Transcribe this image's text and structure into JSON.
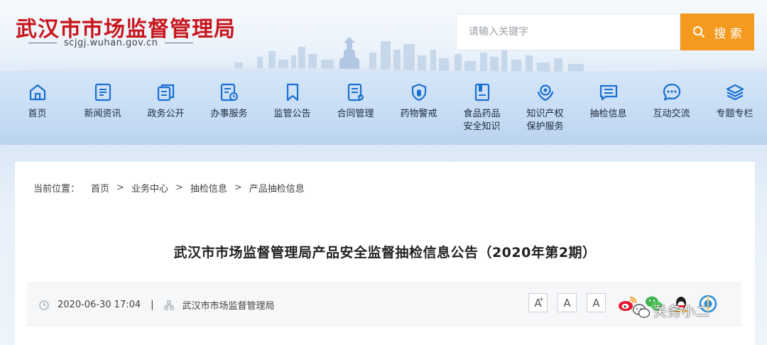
{
  "header": {
    "site_title": "武汉市市场监督管理局",
    "domain": "scjgj.wuhan.gov.cn",
    "search": {
      "placeholder": "请输入关键字",
      "button_label": "搜 索"
    }
  },
  "nav": {
    "items": [
      {
        "label": "首页",
        "icon": "home-icon"
      },
      {
        "label": "新闻资讯",
        "icon": "news-icon"
      },
      {
        "label": "政务公开",
        "icon": "public-affairs-icon"
      },
      {
        "label": "办事服务",
        "icon": "services-icon"
      },
      {
        "label": "监管公告",
        "icon": "bookmark-icon"
      },
      {
        "label": "合同管理",
        "icon": "contract-icon"
      },
      {
        "label": "药物警戒",
        "icon": "shield-icon"
      },
      {
        "label": "食品药品\n安全知识",
        "icon": "book-icon"
      },
      {
        "label": "知识产权\n保护服务",
        "icon": "ip-protection-icon"
      },
      {
        "label": "抽检信息",
        "icon": "message-list-icon"
      },
      {
        "label": "互动交流",
        "icon": "chat-icon"
      },
      {
        "label": "专题专栏",
        "icon": "layers-icon"
      }
    ]
  },
  "breadcrumb": {
    "prefix": "当前位置：",
    "items": [
      "首页",
      "业务中心",
      "抽检信息"
    ],
    "current": "产品抽检信息",
    "separator": ">"
  },
  "article": {
    "title": "武汉市市场监督管理局产品安全监督抽检信息公告（2020年第2期）",
    "datetime": "2020-06-30 17:04",
    "divider": "|",
    "source": "武汉市市场监督管理局"
  },
  "font_controls": {
    "labels": [
      "A",
      "A",
      "A"
    ],
    "plus_marker": "+"
  },
  "share": {
    "icons": [
      "weibo-icon",
      "wechat-icon",
      "qq-icon",
      "qzone-icon"
    ]
  },
  "watermark": {
    "text": "关务小二"
  },
  "colors": {
    "brand_red": "#c8161d",
    "accent_orange": "#f39a1f",
    "nav_blue": "#1a6fd0",
    "nav_bg": "#c6dcf4"
  }
}
